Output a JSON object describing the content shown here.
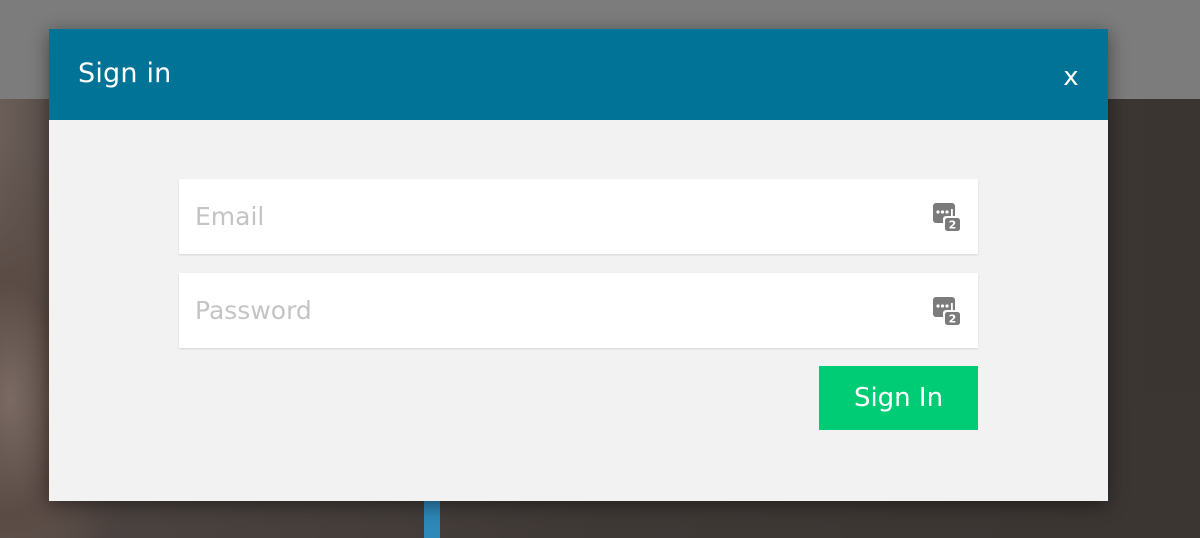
{
  "modal": {
    "title": "Sign in",
    "close_label": "x"
  },
  "form": {
    "email": {
      "value": "",
      "placeholder": "Email",
      "icon": "password-manager-icon"
    },
    "password": {
      "value": "",
      "placeholder": "Password",
      "icon": "password-manager-icon"
    },
    "submit_label": "Sign In"
  },
  "colors": {
    "header": "#007396",
    "panel": "#f2f2f2",
    "submit": "#00cc76",
    "overlay": "#7c7c7c"
  }
}
